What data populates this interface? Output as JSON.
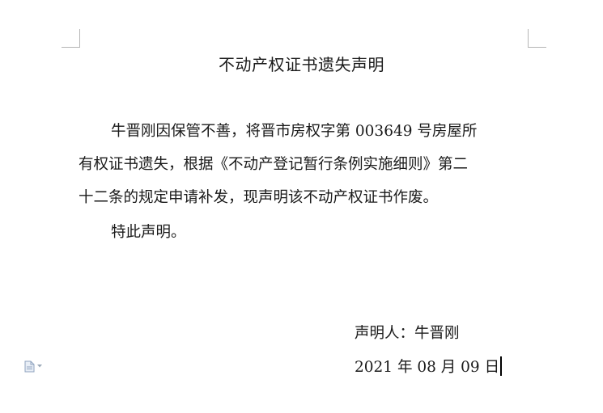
{
  "document": {
    "title": "不动产权证书遗失声明",
    "paragraph_lines": [
      "牛晋刚因保管不善，将晋市房权字第 003649 号房屋所",
      "有权证书遗失，根据《不动产登记暂行条例实施细则》第二",
      "十二条的规定申请补发，现声明该不动产权证书作废。",
      "特此声明。"
    ],
    "signature": {
      "declarant": "声明人：牛晋刚",
      "date": "2021 年 08 月 09 日"
    }
  },
  "icons": {
    "paste_options": "paste-options-icon",
    "dropdown": "chevron-down-icon"
  },
  "colors": {
    "text": "#1a1a1a",
    "margin_marks": "#b5b5b5",
    "icon": "#8fa3bf"
  }
}
